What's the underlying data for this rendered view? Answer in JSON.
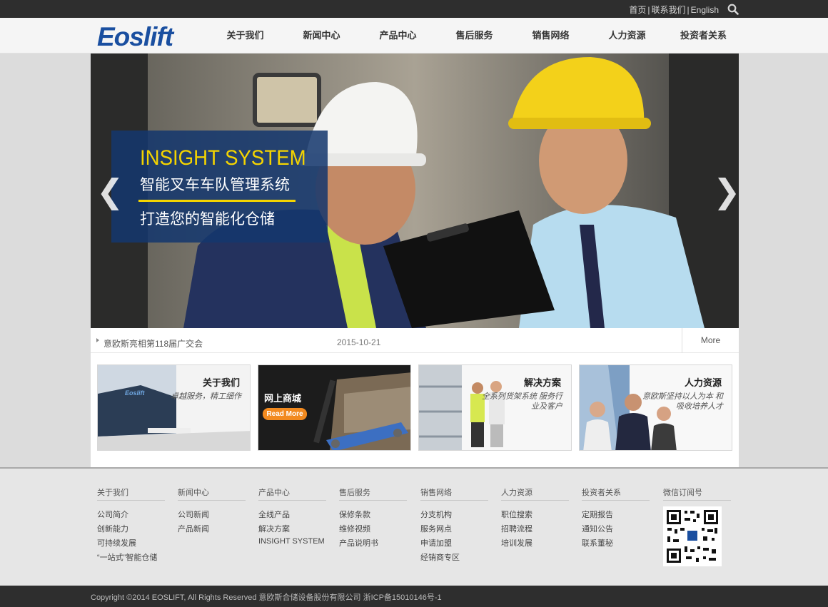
{
  "topbar": {
    "links": [
      "首页",
      "联系我们",
      "English"
    ],
    "search_icon": "search-icon"
  },
  "header": {
    "logo": "Eoslift",
    "nav": [
      "关于我们",
      "新闻中心",
      "产品中心",
      "售后服务",
      "销售网络",
      "人力资源",
      "投资者关系"
    ]
  },
  "banner": {
    "promo_title": "INSIGHT SYSTEM",
    "promo_line1": "智能叉车车队管理系统",
    "promo_line2": "打造您的智能化仓储",
    "prev_arrow": "❮",
    "next_arrow": "❯"
  },
  "news": {
    "title": "意欧斯亮相第118届广交会",
    "date": "2015-10-21",
    "more": "More"
  },
  "cards": [
    {
      "title": "关于我们",
      "sub": "卓越服务，精工细作"
    },
    {
      "title": "网上商城",
      "button": "Read More"
    },
    {
      "title": "解决方案",
      "sub": "全系列货架系统 服务行业及客户"
    },
    {
      "title": "人力资源",
      "sub": "意欧斯坚持以人为本 和吸收培养人才"
    }
  ],
  "footer": {
    "columns": [
      {
        "head": "关于我们",
        "links": [
          "公司简介",
          "创新能力",
          "可持续发展",
          "“一站式”智能仓储"
        ]
      },
      {
        "head": "新闻中心",
        "links": [
          "公司新闻",
          "产品新闻"
        ]
      },
      {
        "head": "产品中心",
        "links": [
          "全线产品",
          "解决方案",
          "INSIGHT SYSTEM"
        ]
      },
      {
        "head": "售后服务",
        "links": [
          "保修条款",
          "维修视频",
          "产品说明书"
        ]
      },
      {
        "head": "销售网络",
        "links": [
          "分支机构",
          "服务网点",
          "申请加盟",
          "经销商专区"
        ]
      },
      {
        "head": "人力资源",
        "links": [
          "职位搜索",
          "招聘流程",
          "培训发展"
        ]
      },
      {
        "head": "投资者关系",
        "links": [
          "定期报告",
          "通知公告",
          "联系董秘"
        ]
      },
      {
        "head": "微信订阅号",
        "links": []
      }
    ]
  },
  "copyright": "Copyright ©2014 EOSLIFT, All Rights Reserved 意欧斯合储设备股份有限公司 浙ICP备15010146号-1",
  "colors": {
    "brand": "#1a4fa0",
    "accent": "#f4d400",
    "orange": "#f28a1f",
    "dark": "#2e2e2e"
  }
}
